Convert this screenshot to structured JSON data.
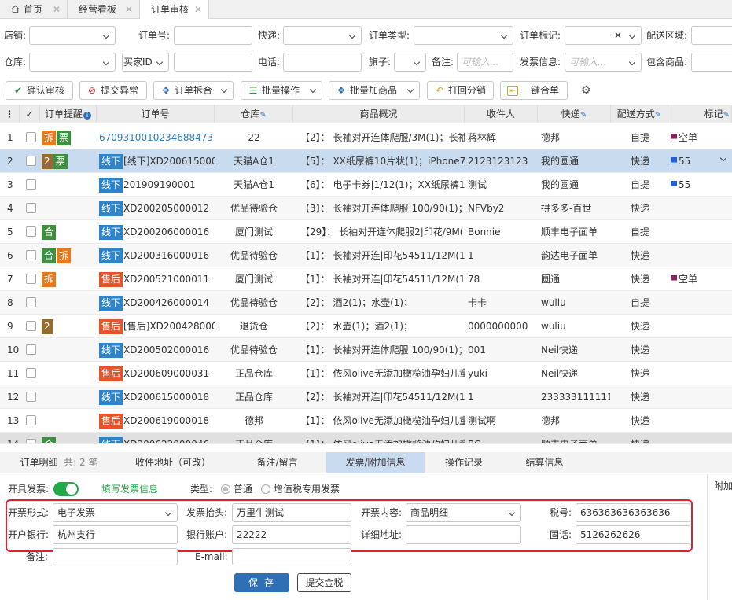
{
  "tabs": [
    {
      "label": "首页"
    },
    {
      "label": "经营看板"
    },
    {
      "label": "订单审核"
    }
  ],
  "filters": {
    "shop_label": "店铺:",
    "order_no_label": "订单号:",
    "express_label": "快递:",
    "order_type_label": "订单类型:",
    "order_mark_label": "订单标记:",
    "delivery_area_label": "配送区域:",
    "warehouse_label": "仓库:",
    "buyer_id_value": "买家ID",
    "phone_label": "电话:",
    "flag_label": "旗子:",
    "remark_label": "备注:",
    "remark_placeholder": "可输入...",
    "invoice_info_label": "发票信息:",
    "invoice_info_placeholder": "可输入...",
    "contains_goods_label": "包含商品:"
  },
  "toolbar": {
    "confirm": "确认审核",
    "submit_exception": "提交异常",
    "split": "订单拆合",
    "batch": "批量操作",
    "batch_add": "批量加商品",
    "return_split": "打回分销",
    "merge": "一键合单"
  },
  "columns": {
    "reminder": "订单提醒",
    "order_no": "订单号",
    "warehouse": "仓库",
    "goods": "商品概况",
    "receiver": "收件人",
    "express": "快递",
    "ship_method": "配送方式",
    "mark": "标记"
  },
  "rows": [
    {
      "n": "1",
      "badges": [
        {
          "t": "拆",
          "c": "orange"
        },
        {
          "t": "票",
          "c": "green"
        }
      ],
      "otype": null,
      "order_no": "6709310010234688473",
      "order_link": true,
      "warehouse": "22",
      "goods": "【2】： 长袖对开连体爬服/3M(1)；长袖对",
      "receiver": "蒋林辉",
      "express": "德邦",
      "ship": "自提",
      "mark": "空单",
      "mark_color": "#8a1f5e"
    },
    {
      "n": "2",
      "badges": [
        {
          "t": "2",
          "c": "brown"
        },
        {
          "t": "票",
          "c": "green"
        }
      ],
      "otype": "线下",
      "ocolor": "blue",
      "order_no": "[线下]XD20061500005",
      "warehouse": "天猫A仓1",
      "goods": "【5】： XX纸尿裤10片状(1)；iPhone7黑",
      "receiver": "2123123123",
      "express": "我的圆通",
      "ship": "快递",
      "mark": "55",
      "mark_color": "#2060d8"
    },
    {
      "n": "3",
      "badges": [],
      "otype": "线下",
      "ocolor": "blue",
      "order_no": "201909190001",
      "warehouse": "天猫A仓1",
      "goods": "【6】： 电子卡券|1/12(1)；XX纸尿裤10片",
      "receiver": "测试",
      "express": "我的圆通",
      "ship": "自提",
      "mark": "55",
      "mark_color": "#2060d8"
    },
    {
      "n": "4",
      "badges": [],
      "otype": "线下",
      "ocolor": "blue",
      "order_no": "XD200205000012",
      "warehouse": "优品待验仓",
      "goods": "【3】： 长袖对开连体爬服|100/90(1)；长",
      "receiver": "NFVby2",
      "express": "拼多多-百世",
      "ship": "快递",
      "mark": "",
      "mark_color": ""
    },
    {
      "n": "5",
      "badges": [
        {
          "t": "合",
          "c": "green"
        }
      ],
      "otype": "线下",
      "ocolor": "blue",
      "order_no": "XD200206000016",
      "warehouse": "厦门测试",
      "goods": "【29】： 长袖对开连体爬服2|印花/9M(1)",
      "receiver": "Bonnie",
      "express": "顺丰电子面单",
      "ship": "自提",
      "mark": "",
      "mark_color": ""
    },
    {
      "n": "6",
      "badges": [
        {
          "t": "合",
          "c": "green"
        },
        {
          "t": "拆",
          "c": "orange"
        }
      ],
      "otype": "线下",
      "ocolor": "blue",
      "order_no": "XD200316000016",
      "warehouse": "优品待验仓",
      "goods": "【1】： 长袖对开连|印花54511/12M(1)；",
      "receiver": "1",
      "express": "韵达电子面单",
      "ship": "快递",
      "mark": "",
      "mark_color": ""
    },
    {
      "n": "7",
      "badges": [
        {
          "t": "拆",
          "c": "orange"
        }
      ],
      "otype": "售后",
      "ocolor": "red",
      "order_no": "XD200521000011",
      "warehouse": "厦门测试",
      "goods": "【1】： 长袖对开连|印花54511/12M(1)；",
      "receiver": "78",
      "express": "圆通",
      "ship": "快递",
      "mark": "空单",
      "mark_color": "#8a1f5e"
    },
    {
      "n": "8",
      "badges": [],
      "otype": "线下",
      "ocolor": "blue",
      "order_no": "XD200426000014",
      "warehouse": "优品待验仓",
      "goods": "【2】： 酒2(1)；水壶(1)；",
      "receiver": "卡卡",
      "express": "wuliu",
      "ship": "自提",
      "mark": "",
      "mark_color": ""
    },
    {
      "n": "9",
      "badges": [
        {
          "t": "2",
          "c": "brown"
        }
      ],
      "otype": "售后",
      "ocolor": "red",
      "order_no": "[售后]XD2004280000",
      "warehouse": "退货仓",
      "goods": "【2】： 水壶(1)；酒2(1)；",
      "receiver": "0000000000",
      "express": "wuliu",
      "ship": "快递",
      "mark": "",
      "mark_color": ""
    },
    {
      "n": "10",
      "badges": [],
      "otype": "线下",
      "ocolor": "blue",
      "order_no": "XD200502000016",
      "warehouse": "优品待验仓",
      "goods": "【1】： 长袖对开连体爬服|100/90(1)；长",
      "receiver": "001",
      "express": "Neil快递",
      "ship": "快递",
      "mark": "",
      "mark_color": ""
    },
    {
      "n": "11",
      "badges": [],
      "otype": "售后",
      "ocolor": "red",
      "order_no": "XD200609000031",
      "warehouse": "正品仓库",
      "goods": "【1】： 依风olive无添加橄榄油孕妇儿童护",
      "receiver": "yuki",
      "express": "Neil快递",
      "ship": "快递",
      "mark": "",
      "mark_color": ""
    },
    {
      "n": "12",
      "badges": [],
      "otype": "线下",
      "ocolor": "blue",
      "order_no": "XD200615000018",
      "warehouse": "正品仓库",
      "goods": "【2】： 长袖对开连|印花54511/12M(1)；",
      "receiver": "1",
      "express": "23333311111111",
      "ship": "快递",
      "mark": "",
      "mark_color": ""
    },
    {
      "n": "13",
      "badges": [],
      "otype": "售后",
      "ocolor": "red",
      "order_no": "XD200619000018",
      "warehouse": "德邦",
      "goods": "【1】： 依风olive无添加橄榄油孕妇儿童护",
      "receiver": "测试啊",
      "express": "德邦",
      "ship": "快递",
      "mark": "",
      "mark_color": ""
    },
    {
      "n": "14",
      "badges": [
        {
          "t": "合",
          "c": "green"
        }
      ],
      "otype": "线下",
      "ocolor": "blue",
      "order_no": "XD200622000046",
      "warehouse": "正品仓库",
      "goods": "【1】： 依风olive无添加橄榄油孕妇儿童护",
      "receiver": "BC",
      "express": "顺丰电子面单",
      "ship": "快递",
      "mark": "",
      "mark_color": ""
    }
  ],
  "detail_tabs": {
    "order_detail": "订单明细",
    "count": "共: 2 笔",
    "address": "收件地址（可改）",
    "remark": "备注/留言",
    "invoice": "发票/附加信息",
    "log": "操作记录",
    "settle": "结算信息"
  },
  "invoice": {
    "issue_label": "开具发票:",
    "fill_link": "填写发票信息",
    "type_label": "类型:",
    "type_normal": "普通",
    "type_vat": "增值税专用发票",
    "extra_label": "附加",
    "form_label": "开票形式:",
    "form_value": "电子发票",
    "title_label": "发票抬头:",
    "title_value": "万里牛测试",
    "content_label": "开票内容:",
    "content_value": "商品明细",
    "tax_label": "税号:",
    "tax_value": "636363636363636",
    "bank_label": "开户银行:",
    "bank_value": "杭州支行",
    "account_label": "银行账户:",
    "account_value": "22222",
    "address_label": "详细地址:",
    "address_value": "",
    "phone_label": "固话:",
    "phone_value": "5126262626",
    "remark_label": "备注:",
    "remark_value": "",
    "email_label": "E-mail:",
    "email_value": "",
    "save": "保 存",
    "submit_tax": "提交金税"
  }
}
